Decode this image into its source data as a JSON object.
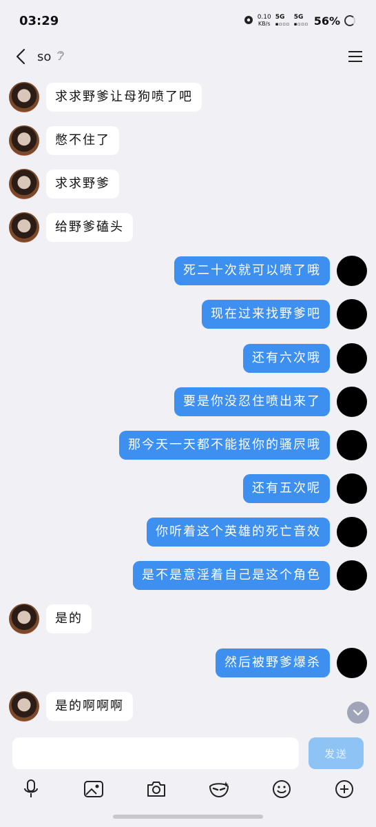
{
  "status_bar": {
    "time": "03:29",
    "net_speed_value": "0.10",
    "net_speed_unit": "KB/s",
    "sim1": "5G",
    "sim2": "5G",
    "battery": "56%"
  },
  "header": {
    "title": "so"
  },
  "messages": [
    {
      "side": "left",
      "text": "求求野爹让母狗喷了吧"
    },
    {
      "side": "left",
      "text": "憋不住了"
    },
    {
      "side": "left",
      "text": "求求野爹"
    },
    {
      "side": "left",
      "text": "给野爹磕头"
    },
    {
      "side": "right",
      "text": "死二十次就可以喷了哦"
    },
    {
      "side": "right",
      "text": "现在过来找野爹吧"
    },
    {
      "side": "right",
      "text": "还有六次哦"
    },
    {
      "side": "right",
      "text": "要是你没忍住喷出来了"
    },
    {
      "side": "right",
      "text": "那今天一天都不能抠你的骚屄哦"
    },
    {
      "side": "right",
      "text": "还有五次呢"
    },
    {
      "side": "right",
      "text": "你听着这个英雄的死亡音效"
    },
    {
      "side": "right",
      "text": "是不是意淫着自己是这个角色"
    },
    {
      "side": "left",
      "text": "是的"
    },
    {
      "side": "right",
      "text": "然后被野爹爆杀"
    },
    {
      "side": "left",
      "text": "是的啊啊啊"
    }
  ],
  "composer": {
    "input_value": "",
    "send_label": "发送"
  },
  "toolbar": {
    "icons": [
      "microphone-icon",
      "image-icon",
      "camera-icon",
      "mask-icon",
      "emoji-icon",
      "plus-icon"
    ]
  },
  "colors": {
    "background": "#f1f1f5",
    "bubble_right": "#3d8ff0",
    "bubble_left": "#ffffff",
    "send_button": "#8ec3f5"
  }
}
